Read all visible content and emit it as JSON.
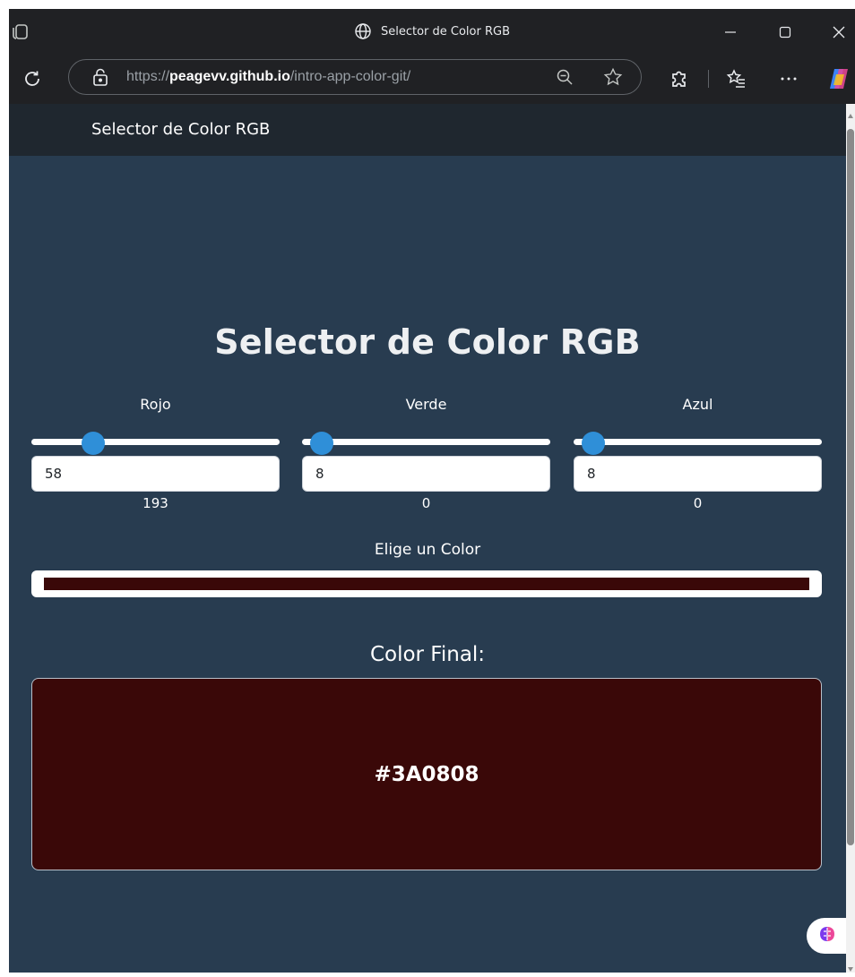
{
  "browser": {
    "window_title": "Selector de Color RGB",
    "url": {
      "scheme": "https://",
      "host": "peagevv.github.io",
      "path": "/intro-app-color-git/"
    },
    "icons": {
      "tabs": "tab-actions-icon",
      "globe": "globe-icon",
      "minimize": "minimize-icon",
      "maximize": "maximize-icon",
      "close": "close-icon",
      "refresh": "refresh-icon",
      "site_info": "lock-icon",
      "zoom": "zoom-out-icon",
      "favorite": "star-icon",
      "extensions": "extensions-icon",
      "favorites": "favorites-icon",
      "more": "more-icon",
      "copilot": "copilot-icon"
    }
  },
  "navbar": {
    "brand": "Selector de Color RGB"
  },
  "main": {
    "title": "Selector de Color RGB",
    "channels": [
      {
        "label": "Rojo",
        "slider_fraction": 0.25,
        "input_value": "58",
        "readout": "193"
      },
      {
        "label": "Verde",
        "slider_fraction": 0.08,
        "input_value": "8",
        "readout": "0"
      },
      {
        "label": "Azul",
        "slider_fraction": 0.08,
        "input_value": "8",
        "readout": "0"
      }
    ],
    "picker_label": "Elige un Color",
    "picker_color": "#3A0808",
    "final_label": "Color Final:",
    "final_hex": "#3A0808",
    "final_color": "#3A0808"
  },
  "colors": {
    "page_bg": "#283c50",
    "navbar_bg": "#1f272f",
    "accent": "#2f8fd8"
  },
  "floating": {
    "assistant_icon": "brain-icon"
  }
}
